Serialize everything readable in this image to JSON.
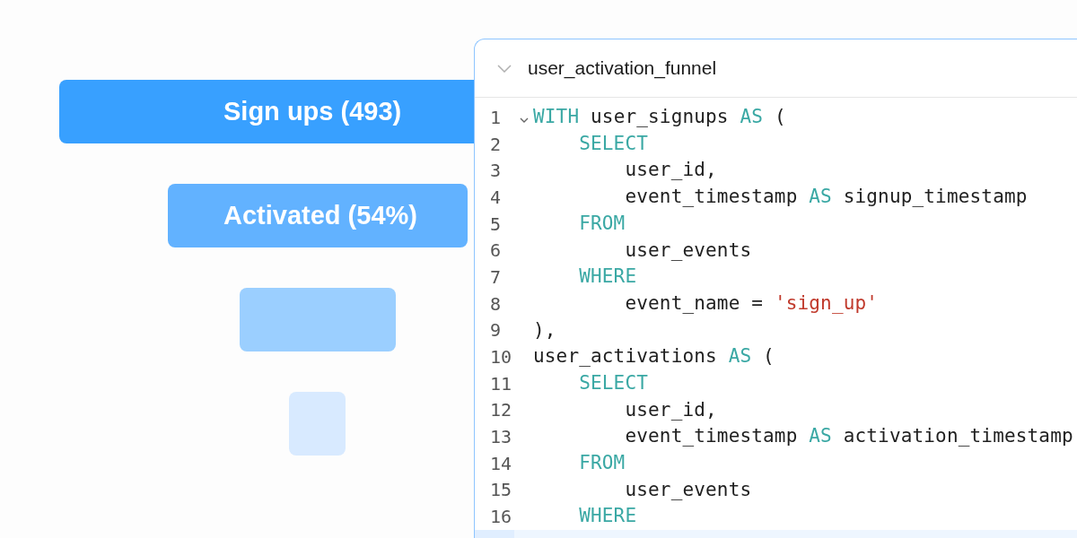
{
  "funnel": {
    "stages": [
      {
        "label": "Sign ups (493)",
        "color": "#38a0ff"
      },
      {
        "label": "Activated (54%)",
        "color": "#62b2ff"
      },
      {
        "color": "#9bcfff"
      },
      {
        "color": "#d8eaff"
      }
    ]
  },
  "editor": {
    "title": "user_activation_funnel",
    "expanded": true,
    "lines": [
      {
        "number": "1",
        "foldable": true,
        "tokens": [
          {
            "kind": "keyword",
            "text": "WITH"
          },
          {
            "kind": "plain",
            "text": " user_signups "
          },
          {
            "kind": "keyword",
            "text": "AS"
          },
          {
            "kind": "plain",
            "text": " ("
          }
        ]
      },
      {
        "number": "2",
        "tokens": [
          {
            "kind": "keyword",
            "text": "    SELECT"
          }
        ]
      },
      {
        "number": "3",
        "tokens": [
          {
            "kind": "plain",
            "text": "        user_id,"
          }
        ]
      },
      {
        "number": "4",
        "tokens": [
          {
            "kind": "plain",
            "text": "        event_timestamp "
          },
          {
            "kind": "keyword",
            "text": "AS"
          },
          {
            "kind": "plain",
            "text": " signup_timestamp"
          }
        ]
      },
      {
        "number": "5",
        "tokens": [
          {
            "kind": "keyword",
            "text": "    FROM"
          }
        ]
      },
      {
        "number": "6",
        "tokens": [
          {
            "kind": "plain",
            "text": "        user_events"
          }
        ]
      },
      {
        "number": "7",
        "tokens": [
          {
            "kind": "keyword",
            "text": "    WHERE"
          }
        ]
      },
      {
        "number": "8",
        "tokens": [
          {
            "kind": "plain",
            "text": "        event_name = "
          },
          {
            "kind": "string",
            "text": "'sign_up'"
          }
        ]
      },
      {
        "number": "9",
        "tokens": [
          {
            "kind": "plain",
            "text": "),"
          }
        ]
      },
      {
        "number": "10",
        "tokens": [
          {
            "kind": "plain",
            "text": "user_activations "
          },
          {
            "kind": "keyword",
            "text": "AS"
          },
          {
            "kind": "plain",
            "text": " ("
          }
        ]
      },
      {
        "number": "11",
        "tokens": [
          {
            "kind": "keyword",
            "text": "    SELECT"
          }
        ]
      },
      {
        "number": "12",
        "tokens": [
          {
            "kind": "plain",
            "text": "        user_id,"
          }
        ]
      },
      {
        "number": "13",
        "tokens": [
          {
            "kind": "plain",
            "text": "        event_timestamp "
          },
          {
            "kind": "keyword",
            "text": "AS"
          },
          {
            "kind": "plain",
            "text": " activation_timestamp"
          }
        ]
      },
      {
        "number": "14",
        "tokens": [
          {
            "kind": "keyword",
            "text": "    FROM"
          }
        ]
      },
      {
        "number": "15",
        "tokens": [
          {
            "kind": "plain",
            "text": "        user_events"
          }
        ]
      },
      {
        "number": "16",
        "tokens": [
          {
            "kind": "keyword",
            "text": "    WHERE"
          }
        ]
      },
      {
        "current": true
      }
    ]
  }
}
